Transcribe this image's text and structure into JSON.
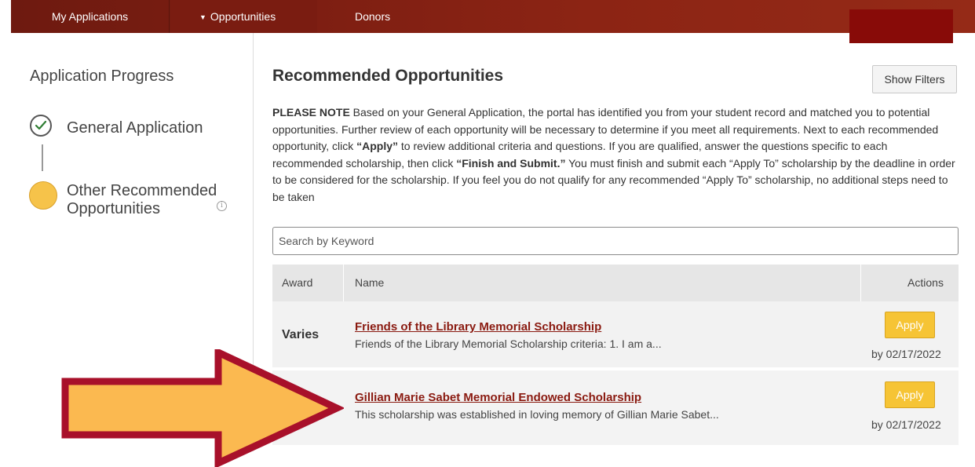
{
  "nav": {
    "tabs": [
      {
        "label": "My Applications"
      },
      {
        "label": "Opportunities",
        "caret": "▼"
      },
      {
        "label": "Donors"
      }
    ]
  },
  "sidebar": {
    "title": "Application Progress",
    "steps": [
      {
        "label": "General Application",
        "status": "complete",
        "icon": "check-icon"
      },
      {
        "label_line1": "Other Recommended",
        "label_line2": "Opportunities",
        "status": "current",
        "icon": "info-icon"
      }
    ]
  },
  "main": {
    "title": "Recommended Opportunities",
    "show_filters_label": "Show Filters",
    "note": {
      "lead": "PLEASE NOTE",
      "p1": " Based on your General Application, the portal has identified you from your student record and matched you to potential opportunities. Further review of each opportunity will be necessary to determine if you meet all requirements. Next to each recommended opportunity, click ",
      "b1": "“Apply”",
      "p2": " to review additional criteria and questions. If you are qualified, answer the questions specific to each recommended scholarship, then click ",
      "b2": "“Finish and Submit.”",
      "p3": " You must finish and submit each “Apply To” scholarship by the deadline in order to be considered for the scholarship. If you feel you do not qualify for any recommended “Apply To” scholarship, no additional steps need to be taken"
    },
    "search_placeholder": "Search by Keyword",
    "table": {
      "headers": {
        "award": "Award",
        "name": "Name",
        "actions": "Actions"
      },
      "rows": [
        {
          "award": "Varies",
          "name": "Friends of the Library Memorial Scholarship",
          "description": "Friends of the Library Memorial Scholarship criteria: 1. I am a...",
          "apply_label": "Apply",
          "deadline": "by 02/17/2022"
        },
        {
          "award": "",
          "name": "Gillian Marie Sabet Memorial Endowed Scholarship",
          "description": "This scholarship was established in loving memory of Gillian Marie Sabet...",
          "apply_label": "Apply",
          "deadline": "by 02/17/2022"
        }
      ]
    }
  },
  "colors": {
    "nav_dark": "#6e1a10",
    "nav_light": "#952a17",
    "link": "#8a1a10",
    "apply": "#f6c435",
    "current_step": "#f6c34a",
    "arrow_fill": "#fbb950",
    "arrow_stroke": "#a8102a"
  }
}
